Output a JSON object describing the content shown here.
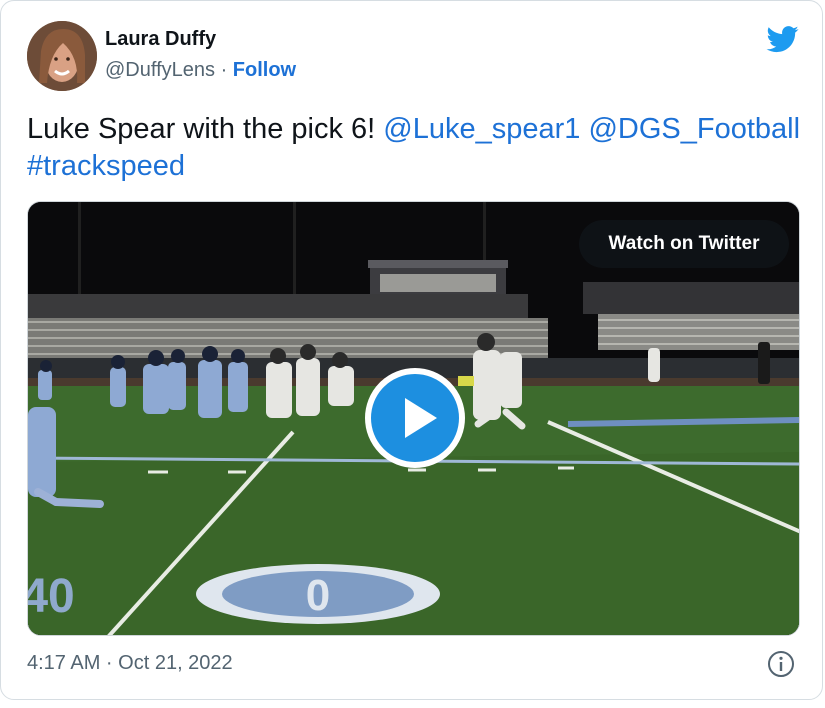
{
  "author": {
    "name": "Laura Duffy",
    "handle": "@DuffyLens",
    "separator": "·",
    "follow_label": "Follow"
  },
  "tweet": {
    "text": "Luke Spear with the pick 6! ",
    "mentions": [
      "@Luke_spear1",
      "@DGS_Football"
    ],
    "hashtag": "#trackspeed",
    "timestamp": "4:17 AM · Oct 21, 2022"
  },
  "media": {
    "watch_label": "Watch on Twitter",
    "field_number_left": "40",
    "field_number_right": "0"
  },
  "icons": {
    "brand": "twitter-bird-icon",
    "play": "play-icon",
    "info": "info-icon"
  },
  "colors": {
    "accent": "#1d71d6",
    "twitter_blue": "#1d9bf0",
    "text_secondary": "#536471",
    "play_button": "#1d8fe0"
  }
}
